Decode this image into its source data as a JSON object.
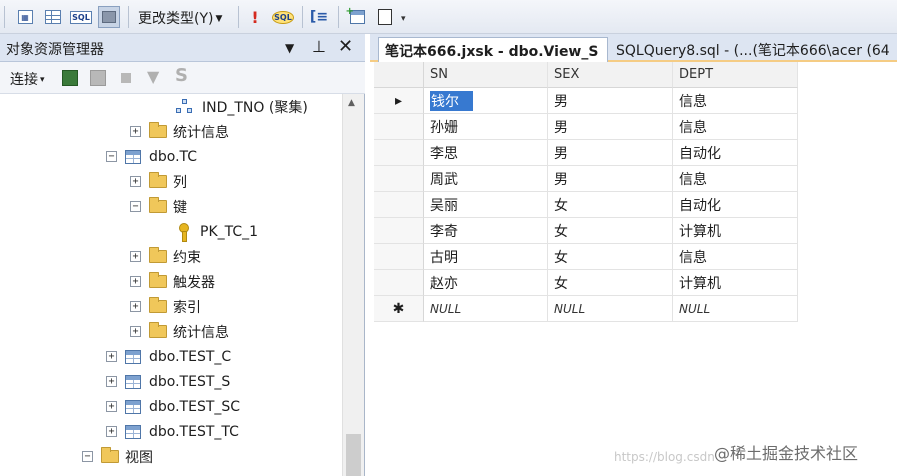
{
  "toolbar": {
    "change_type_label": "更改类型(Y)",
    "icons": [
      "results-pane-icon",
      "grid-icon",
      "sql-icon",
      "diagram-icon",
      "change-type-menu",
      "execute-icon",
      "verify-sql-icon",
      "add-group-by-icon",
      "add-table-icon",
      "add-derived-table-icon",
      "overflow-icon"
    ]
  },
  "object_explorer": {
    "title": "对象资源管理器",
    "title_buttons": [
      "dropdown-icon",
      "pin-icon",
      "close-icon"
    ],
    "connect_label": "连接",
    "tree": [
      {
        "label": "IND_TNO (聚集)",
        "type": "index",
        "level": 3,
        "expander": ""
      },
      {
        "label": "统计信息",
        "type": "folder",
        "level": 2,
        "expander": "+"
      },
      {
        "label": "dbo.TC",
        "type": "table",
        "level": 1,
        "expander": "−"
      },
      {
        "label": "列",
        "type": "folder",
        "level": 2,
        "expander": "+"
      },
      {
        "label": "键",
        "type": "folder",
        "level": 2,
        "expander": "−"
      },
      {
        "label": "PK_TC_1",
        "type": "key",
        "level": 3,
        "expander": ""
      },
      {
        "label": "约束",
        "type": "folder",
        "level": 2,
        "expander": "+"
      },
      {
        "label": "触发器",
        "type": "folder",
        "level": 2,
        "expander": "+"
      },
      {
        "label": "索引",
        "type": "folder",
        "level": 2,
        "expander": "+"
      },
      {
        "label": "统计信息",
        "type": "folder",
        "level": 2,
        "expander": "+"
      },
      {
        "label": "dbo.TEST_C",
        "type": "table",
        "level": 1,
        "expander": "+"
      },
      {
        "label": "dbo.TEST_S",
        "type": "table",
        "level": 1,
        "expander": "+"
      },
      {
        "label": "dbo.TEST_SC",
        "type": "table",
        "level": 1,
        "expander": "+"
      },
      {
        "label": "dbo.TEST_TC",
        "type": "table",
        "level": 1,
        "expander": "+"
      },
      {
        "label": "视图",
        "type": "folder",
        "level": 0,
        "expander": "−"
      }
    ]
  },
  "tabs": {
    "active": "笔记本666.jxsk - dbo.View_S",
    "inactive": "SQLQuery8.sql - (...(笔记本666\\acer (64"
  },
  "grid": {
    "columns": [
      "SN",
      "SEX",
      "DEPT"
    ],
    "current_row_marker": "▸",
    "new_row_marker": "✱",
    "rows": [
      [
        "钱尔",
        "男",
        "信息"
      ],
      [
        "孙姗",
        "男",
        "信息"
      ],
      [
        "李思",
        "男",
        "自动化"
      ],
      [
        "周武",
        "男",
        "信息"
      ],
      [
        "吴丽",
        "女",
        "自动化"
      ],
      [
        "李奇",
        "女",
        "计算机"
      ],
      [
        "古明",
        "女",
        "信息"
      ],
      [
        "赵亦",
        "女",
        "计算机"
      ]
    ],
    "null_label": "NULL"
  },
  "watermark": {
    "text": "@稀土掘金技术社区",
    "url": "https://blog.csdn"
  }
}
